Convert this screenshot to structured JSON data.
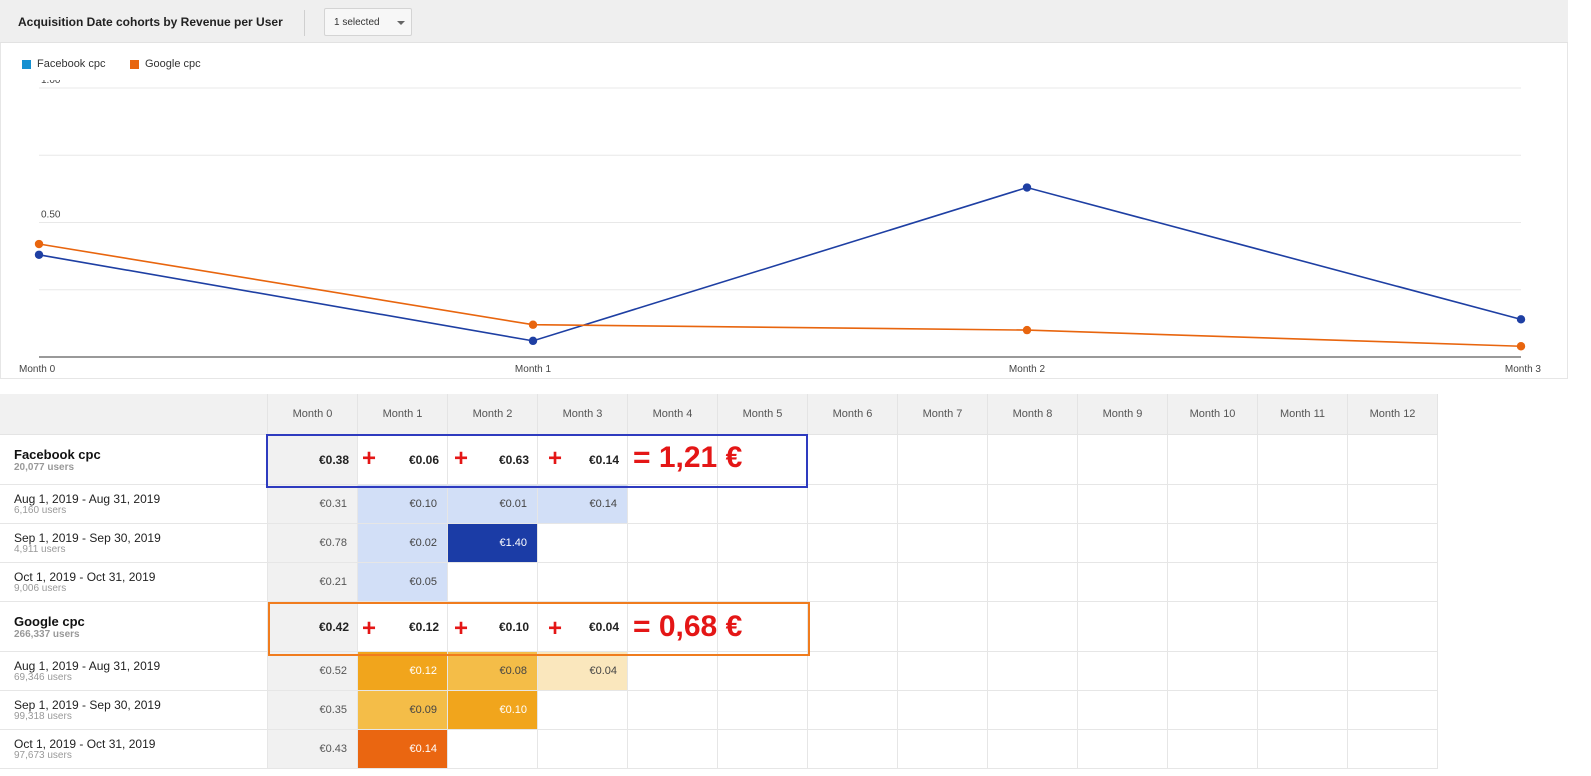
{
  "header": {
    "title": "Acquisition Date cohorts by Revenue per User",
    "selector_label": "1 selected"
  },
  "chart_data": {
    "type": "line",
    "x": [
      "Month 0",
      "Month 1",
      "Month 2",
      "Month 3"
    ],
    "yticks": [
      "1.00",
      "0.50"
    ],
    "ylim": [
      0,
      1.0
    ],
    "grid": true,
    "legend_position": "top-left",
    "series": [
      {
        "name": "Facebook cpc",
        "color": "#1e3fa3",
        "values": [
          0.38,
          0.06,
          0.63,
          0.14
        ]
      },
      {
        "name": "Google cpc",
        "color": "#e8650e",
        "values": [
          0.42,
          0.12,
          0.1,
          0.04
        ]
      }
    ]
  },
  "table": {
    "columns": [
      "Month 0",
      "Month 1",
      "Month 2",
      "Month 3",
      "Month 4",
      "Month 5",
      "Month 6",
      "Month 7",
      "Month 8",
      "Month 9",
      "Month 10",
      "Month 11",
      "Month 12"
    ],
    "groups": [
      {
        "name": "Facebook cpc",
        "users": "20,077 users",
        "values": [
          "€0.38",
          "€0.06",
          "€0.63",
          "€0.14"
        ],
        "rows": [
          {
            "range": "Aug 1, 2019 - Aug 31, 2019",
            "users": "6,160 users",
            "values": [
              "€0.31",
              "€0.10",
              "€0.01",
              "€0.14"
            ]
          },
          {
            "range": "Sep 1, 2019 - Sep 30, 2019",
            "users": "4,911 users",
            "values": [
              "€0.78",
              "€0.02",
              "€1.40"
            ]
          },
          {
            "range": "Oct 1, 2019 - Oct 31, 2019",
            "users": "9,006 users",
            "values": [
              "€0.21",
              "€0.05"
            ]
          }
        ]
      },
      {
        "name": "Google cpc",
        "users": "266,337 users",
        "values": [
          "€0.42",
          "€0.12",
          "€0.10",
          "€0.04"
        ],
        "rows": [
          {
            "range": "Aug 1, 2019 - Aug 31, 2019",
            "users": "69,346 users",
            "values": [
              "€0.52",
              "€0.12",
              "€0.08",
              "€0.04"
            ]
          },
          {
            "range": "Sep 1, 2019 - Sep 30, 2019",
            "users": "99,318 users",
            "values": [
              "€0.35",
              "€0.09",
              "€0.10"
            ]
          },
          {
            "range": "Oct 1, 2019 - Oct 31, 2019",
            "users": "97,673 users",
            "values": [
              "€0.43",
              "€0.14"
            ]
          }
        ]
      }
    ]
  },
  "annotations": {
    "plus": "+",
    "facebook_total": "= 1,21 €",
    "google_total": "= 0,68 €",
    "facebook_box_color": "#2e3bbf",
    "google_box_color": "#f07c1e"
  },
  "heat_colors": {
    "fb": {
      "€0.10": "#d2dff7",
      "€0.01": "#d2dff7",
      "€0.14": "#d2dff7",
      "€0.02": "#d2dff7",
      "€1.40": "#1b3ca6",
      "€0.05": "#d2dff7"
    },
    "gg": {
      "€0.12": "#f1a51c",
      "€0.08": "#f4bd48",
      "€0.04": "#fae7bd",
      "€0.09": "#f4bd48",
      "€0.10": "#f1a51c",
      "€0.14": "#ea6611"
    }
  }
}
